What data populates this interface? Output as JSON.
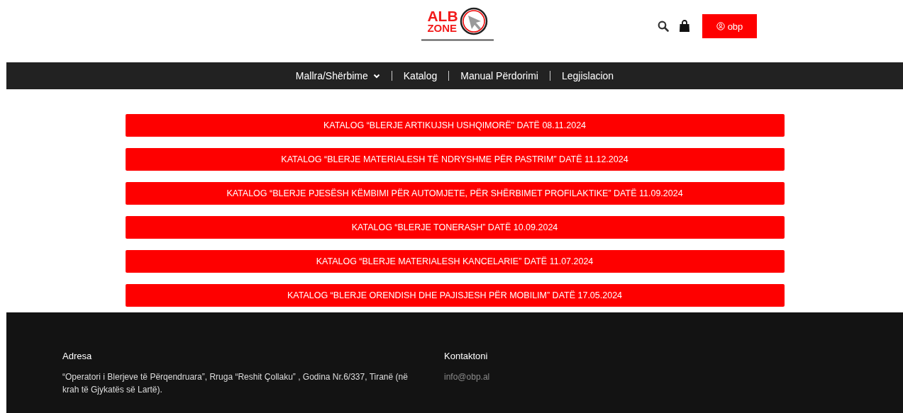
{
  "logo": {
    "line_1": "ALB",
    "line_2": "ZONE"
  },
  "header": {
    "account_button": "obp"
  },
  "nav": [
    {
      "label": "Mallra/Shërbime",
      "dropdown": true
    },
    {
      "label": "Katalog",
      "dropdown": false
    },
    {
      "label": "Manual Përdorimi",
      "dropdown": false
    },
    {
      "label": "Legjislacion",
      "dropdown": false
    }
  ],
  "catalogs": [
    "KATALOG “BLERJE ARTIKUJSH USHQIMORË\" DATË 08.11.2024",
    "KATALOG “BLERJE MATERIALESH TË NDRYSHME PËR PASTRIM” DATË 11.12.2024",
    "KATALOG “BLERJE PJESËSH KËMBIMI PËR AUTOMJETE, PËR SHËRBIMET PROFILAKTIKE” DATË 11.09.2024",
    "KATALOG “BLERJE TONERASH” DATË 10.09.2024",
    "KATALOG “BLERJE MATERIALESH KANCELARIE” DATË 11.07.2024",
    "KATALOG “BLERJE ORENDISH DHE PAJISJESH PËR MOBILIM” DATË 17.05.2024"
  ],
  "footer": {
    "address_heading": "Adresa",
    "address": "“Operatori i Blerjeve të Përqendruara”, Rruga “Reshit Çollaku” , Godina Nr.6/337, Tiranë (në krah të Gjykatës së Lartë).",
    "contact_heading": "Kontaktoni",
    "email": "info@obp.al"
  }
}
